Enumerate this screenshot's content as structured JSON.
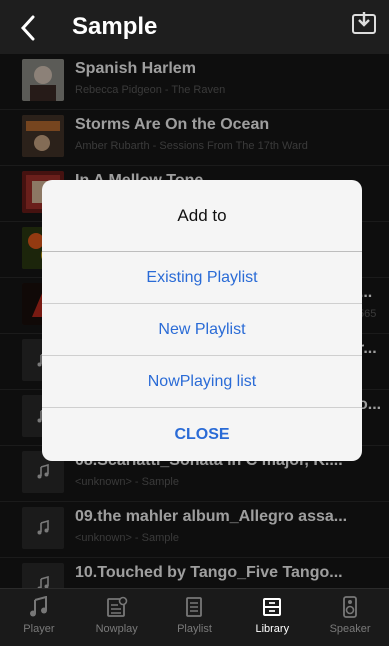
{
  "header": {
    "title": "Sample"
  },
  "tracks": [
    {
      "title": "Spanish Harlem",
      "subtitle": "Rebecca Pidgeon - The Raven",
      "art": "art-1"
    },
    {
      "title": "Storms Are On the Ocean",
      "subtitle": "Amber Rubarth - Sessions From The 17th Ward",
      "art": "art-2"
    },
    {
      "title": "In A Mellow Tone",
      "subtitle": "",
      "art": "art-3"
    },
    {
      "title": "",
      "subtitle": "",
      "art": "art-4"
    },
    {
      "title": "s...",
      "subtitle": "565",
      "art": "art-5"
    },
    {
      "title": "r...",
      "subtitle": "",
      "art": "note"
    },
    {
      "title": "o...",
      "subtitle": "",
      "art": "note"
    },
    {
      "title": "08.Scarlatti_Sonata in C major, K....",
      "subtitle": "<unknown> - Sample",
      "art": "note"
    },
    {
      "title": "09.the mahler album_Allegro assa...",
      "subtitle": "<unknown> - Sample",
      "art": "note"
    },
    {
      "title": "10.Touched by Tango_Five Tango...",
      "subtitle": "",
      "art": "note"
    }
  ],
  "dialog": {
    "title": "Add to",
    "options": [
      "Existing Playlist",
      "New Playlist",
      "NowPlaying list"
    ],
    "close": "CLOSE"
  },
  "tabs": [
    {
      "label": "Player",
      "icon": "music-note-icon",
      "active": false
    },
    {
      "label": "Nowplay",
      "icon": "nowplay-icon",
      "active": false
    },
    {
      "label": "Playlist",
      "icon": "playlist-icon",
      "active": false
    },
    {
      "label": "Library",
      "icon": "library-icon",
      "active": true
    },
    {
      "label": "Speaker",
      "icon": "speaker-icon",
      "active": false
    }
  ],
  "colors": {
    "accent": "#2a6bd6",
    "background": "#1c1c1c"
  }
}
